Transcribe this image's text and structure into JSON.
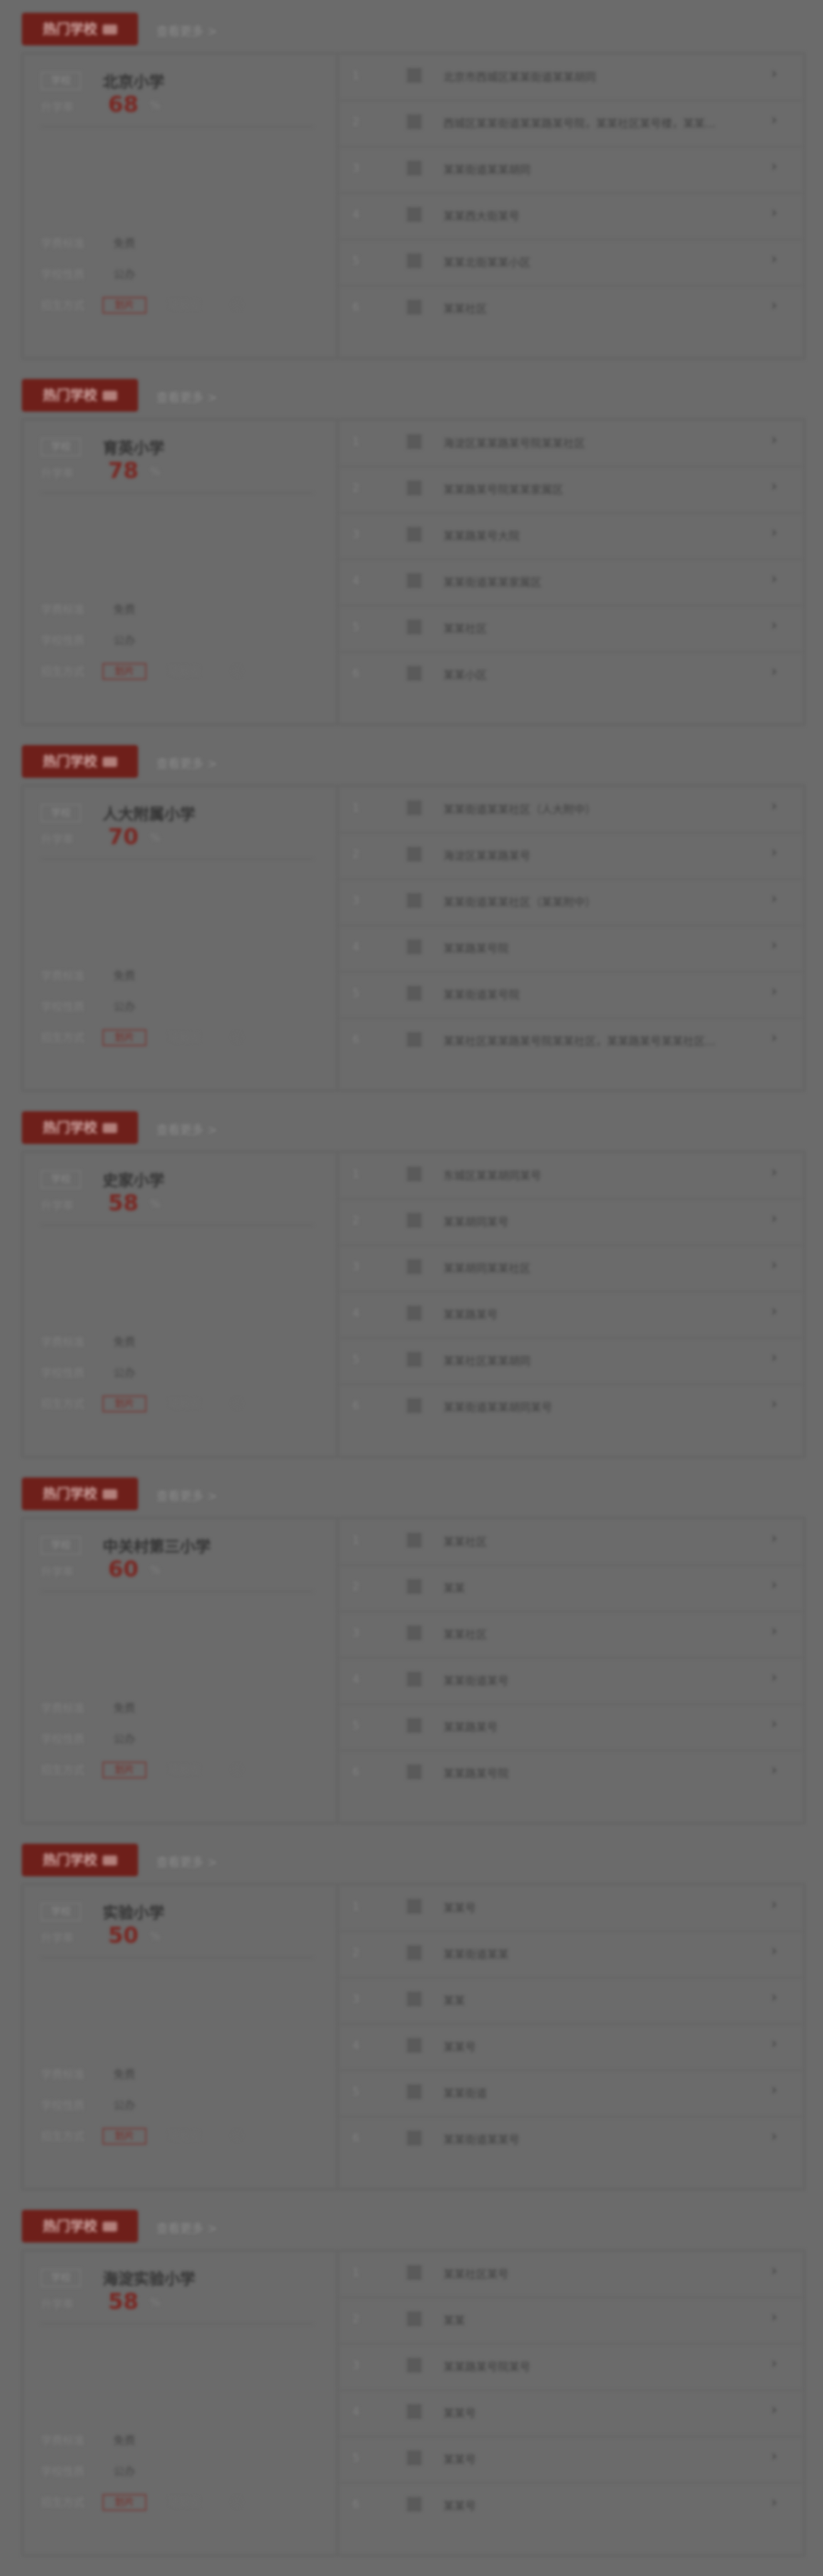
{
  "more_label": "查看更多 >",
  "tag_label": "热门学校",
  "rate_label": "升学率",
  "rate_unit": "%",
  "labels": {
    "tuition": "学费标准",
    "nature": "学校性质",
    "enroll": "招生方式",
    "enroll_btn": "划片",
    "apply": "可报名",
    "badge": "学校"
  },
  "sections": [
    {
      "school": "北京小学",
      "rate": "68",
      "tuition": "免费",
      "nature": "公办",
      "rows": [
        {
          "idx": "1",
          "text": "北京市西城区某某街道某某胡同"
        },
        {
          "idx": "2",
          "text": "西城区某某街道某某路某号院，某某社区某号楼，某某..."
        },
        {
          "idx": "3",
          "text": "某某街道某某胡同"
        },
        {
          "idx": "4",
          "text": "某某西大街某号"
        },
        {
          "idx": "5",
          "text": "某某北街某某小区"
        },
        {
          "idx": "6",
          "text": "某某社区"
        }
      ]
    },
    {
      "school": "育英小学",
      "rate": "78",
      "tuition": "免费",
      "nature": "公办",
      "rows": [
        {
          "idx": "1",
          "text": "海淀区某某路某号院某某社区"
        },
        {
          "idx": "2",
          "text": "某某路某号院某某家属区"
        },
        {
          "idx": "3",
          "text": "某某路某号大院"
        },
        {
          "idx": "4",
          "text": "某某街道某某家属区"
        },
        {
          "idx": "5",
          "text": "某某社区"
        },
        {
          "idx": "6",
          "text": "某某小区"
        }
      ]
    },
    {
      "school": "人大附属小学",
      "rate": "70",
      "tuition": "免费",
      "nature": "公办",
      "rows": [
        {
          "idx": "1",
          "text": "某某街道某某社区（人大附中）"
        },
        {
          "idx": "2",
          "text": "海淀区某某路某号"
        },
        {
          "idx": "3",
          "text": "某某街道某某社区（某某附中）"
        },
        {
          "idx": "4",
          "text": "某某路某号院"
        },
        {
          "idx": "5",
          "text": "某某街道某号院"
        },
        {
          "idx": "6",
          "text": "某某社区某某路某号院某某社区，某某路某号某某社区..."
        }
      ]
    },
    {
      "school": "史家小学",
      "rate": "58",
      "tuition": "免费",
      "nature": "公办",
      "rows": [
        {
          "idx": "1",
          "text": "东城区某某胡同某号"
        },
        {
          "idx": "2",
          "text": "某某胡同某号"
        },
        {
          "idx": "3",
          "text": "某某胡同某某社区"
        },
        {
          "idx": "4",
          "text": "某某路某号"
        },
        {
          "idx": "5",
          "text": "某某社区某某胡同"
        },
        {
          "idx": "6",
          "text": "某某街道某某胡同某号"
        }
      ]
    },
    {
      "school": "中关村第三小学",
      "rate": "60",
      "tuition": "免费",
      "nature": "公办",
      "rows": [
        {
          "idx": "1",
          "text": "某某社区"
        },
        {
          "idx": "2",
          "text": "某某"
        },
        {
          "idx": "3",
          "text": "某某社区"
        },
        {
          "idx": "4",
          "text": "某某街道某号"
        },
        {
          "idx": "5",
          "text": "某某路某号"
        },
        {
          "idx": "6",
          "text": "某某路某号院"
        }
      ]
    },
    {
      "school": "实验小学",
      "rate": "50",
      "tuition": "免费",
      "nature": "公办",
      "rows": [
        {
          "idx": "1",
          "text": "某某号"
        },
        {
          "idx": "2",
          "text": "某某街道某某"
        },
        {
          "idx": "3",
          "text": "某某"
        },
        {
          "idx": "4",
          "text": "某某号"
        },
        {
          "idx": "5",
          "text": "某某街道"
        },
        {
          "idx": "6",
          "text": "某某街道某某号"
        }
      ]
    },
    {
      "school": "海淀实验小学",
      "rate": "58",
      "tuition": "免费",
      "nature": "公办",
      "rows": [
        {
          "idx": "1",
          "text": "某某社区某号"
        },
        {
          "idx": "2",
          "text": "某某"
        },
        {
          "idx": "3",
          "text": "某某路某号院某号"
        },
        {
          "idx": "4",
          "text": "某某号"
        },
        {
          "idx": "5",
          "text": "某某号"
        },
        {
          "idx": "6",
          "text": "某某号"
        }
      ]
    }
  ]
}
